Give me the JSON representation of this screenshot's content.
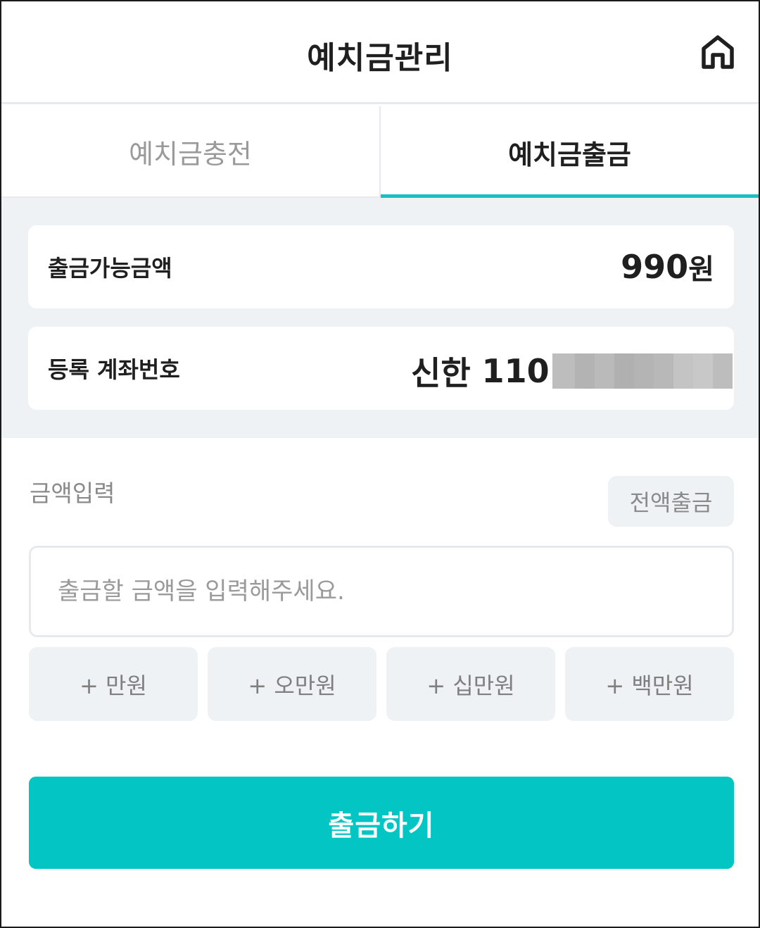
{
  "header": {
    "title": "예치금관리",
    "home_icon": "home-icon"
  },
  "tabs": [
    {
      "label": "예치금충전",
      "active": false
    },
    {
      "label": "예치금출금",
      "active": true
    }
  ],
  "info": {
    "available_label": "출금가능금액",
    "available_amount": "990",
    "available_unit": "원",
    "account_label": "등록 계좌번호",
    "account_bank": "신한",
    "account_prefix": "110"
  },
  "amount": {
    "label": "금액입력",
    "full_button": "전액출금",
    "input_placeholder": "출금할 금액을 입력해주세요.",
    "input_value": ""
  },
  "quick_buttons": [
    {
      "label": "+ 만원"
    },
    {
      "label": "+ 오만원"
    },
    {
      "label": "+ 십만원"
    },
    {
      "label": "+ 백만원"
    }
  ],
  "submit_label": "출금하기",
  "colors": {
    "accent": "#03c5c3",
    "tab_underline": "#1bbfc3",
    "panel_bg": "#eef2f5"
  }
}
